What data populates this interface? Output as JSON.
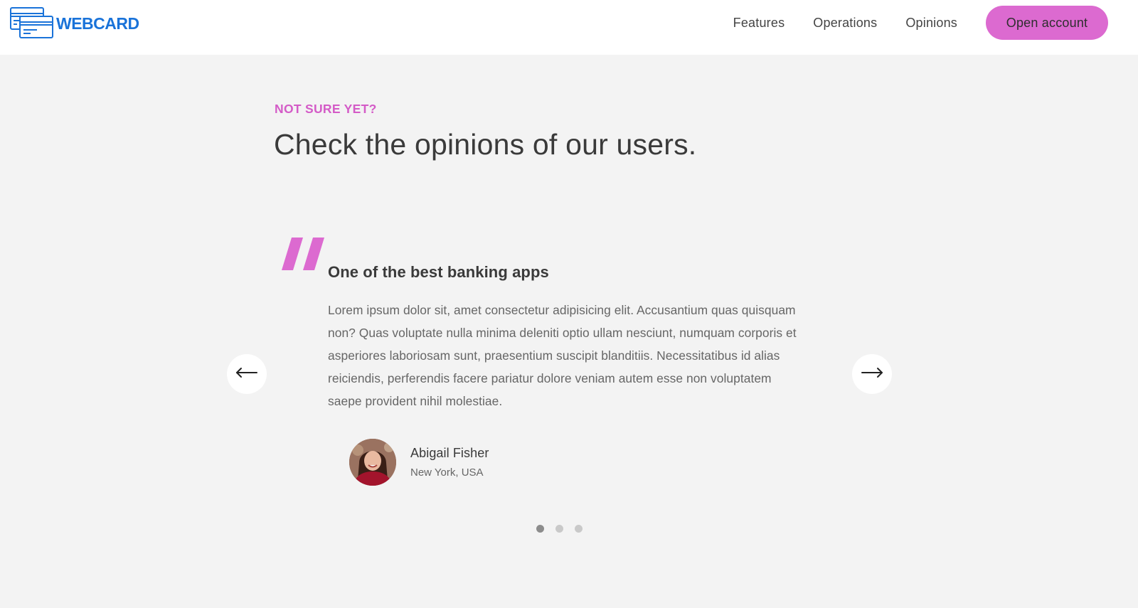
{
  "brand": {
    "name": "WEBCARD",
    "color": "#1a73d9"
  },
  "nav": {
    "links": [
      "Features",
      "Operations",
      "Opinions"
    ],
    "cta_label": "Open account",
    "cta_color": "#dc6ad0"
  },
  "section": {
    "label": "NOT SURE YET?",
    "title": "Check the opinions of our users."
  },
  "testimonial": {
    "icon": "quote-icon",
    "heading": "One of the best banking apps",
    "text": "Lorem ipsum dolor sit, amet consectetur adipisicing elit. Accusantium quas quisquam non? Quas voluptate nulla minima deleniti optio ullam nesciunt, numquam corporis et asperiores laboriosam sunt, praesentium suscipit blanditiis. Necessitatibus id alias reiciendis, perferendis facere pariatur dolore veniam autem esse non voluptatem saepe provident nihil molestiae.",
    "author": {
      "name": "Abigail Fisher",
      "location": "New York, USA"
    }
  },
  "slider": {
    "prev_icon": "arrow-left-icon",
    "next_icon": "arrow-right-icon",
    "dot_count": 3,
    "active_dot": 1
  },
  "colors": {
    "accent": "#dc6ad0",
    "label": "#d45bc7",
    "background": "#f3f3f3"
  }
}
